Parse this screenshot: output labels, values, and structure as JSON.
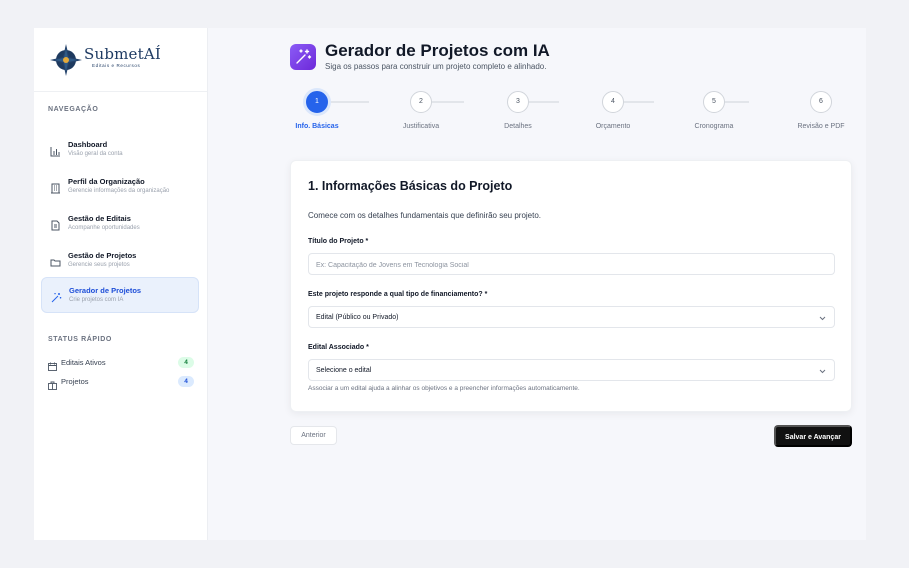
{
  "brand": {
    "name": "SubmetAÍ",
    "tagline": "Editais e Recursos"
  },
  "sidebar": {
    "nav_label": "NAVEGAÇÃO",
    "items": [
      {
        "title": "Dashboard",
        "subtitle": "Visão geral da conta",
        "icon": "bar-chart-icon"
      },
      {
        "title": "Perfil da Organização",
        "subtitle": "Gerencie informações da organização",
        "icon": "building-icon"
      },
      {
        "title": "Gestão de Editais",
        "subtitle": "Acompanhe oportunidades",
        "icon": "document-icon"
      },
      {
        "title": "Gestão de Projetos",
        "subtitle": "Gerencie seus projetos",
        "icon": "folder-icon"
      },
      {
        "title": "Gerador de Projetos",
        "subtitle": "Crie projetos com IA",
        "icon": "magic-wand-icon",
        "active": true
      }
    ],
    "status_label": "STATUS RÁPIDO",
    "status": [
      {
        "label": "Editais Ativos",
        "count": "4",
        "color": "#15803d",
        "icon": "calendar-icon"
      },
      {
        "label": "Projetos",
        "count": "4",
        "color": "#1d4ed8",
        "icon": "briefcase-icon"
      }
    ]
  },
  "header": {
    "title": "Gerador de Projetos com IA",
    "subtitle": "Siga os passos para construir um projeto completo e alinhado.",
    "icon": "magic-wand-icon",
    "icon_color": "#7c3aed"
  },
  "stepper": {
    "current": 1,
    "steps": [
      {
        "number": "1",
        "label": "Info. Básicas"
      },
      {
        "number": "2",
        "label": "Justificativa"
      },
      {
        "number": "3",
        "label": "Detalhes"
      },
      {
        "number": "4",
        "label": "Orçamento"
      },
      {
        "number": "5",
        "label": "Cronograma"
      },
      {
        "number": "6",
        "label": "Revisão e PDF"
      }
    ]
  },
  "form": {
    "title": "1. Informações Básicas do Projeto",
    "description": "Comece com os detalhes fundamentais que definirão seu projeto.",
    "project_title_label": "Título do Projeto *",
    "project_title_placeholder": "Ex: Capacitação de Jovens em Tecnologia Social",
    "project_title_value": "",
    "funding_label": "Este projeto responde a qual tipo de financiamento? *",
    "funding_value": "Edital (Público ou Privado)",
    "edital_label": "Edital Associado *",
    "edital_value": "Selecione o edital",
    "edital_hint": "Associar a um edital ajuda a alinhar os objetivos e a preencher informações automaticamente."
  },
  "actions": {
    "back_label": "Anterior",
    "next_label": "Salvar e Avançar"
  },
  "colors": {
    "accent": "#2563eb",
    "primary_button": "#111111"
  }
}
